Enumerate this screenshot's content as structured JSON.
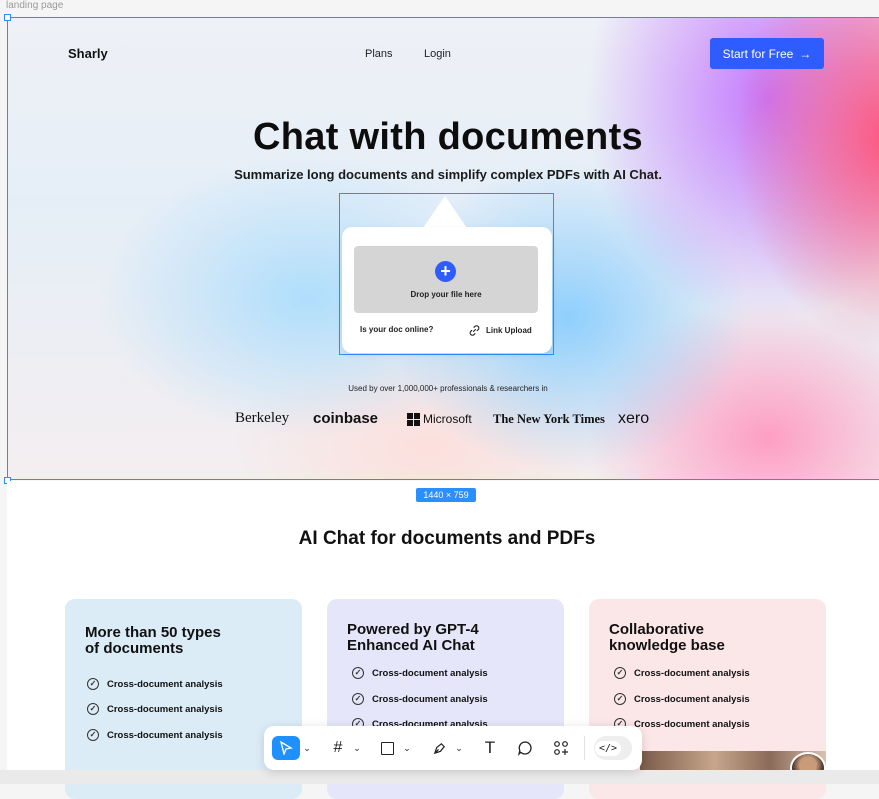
{
  "frame_label": "landing page",
  "header": {
    "brand": "Sharly",
    "nav": [
      "Plans",
      "Login"
    ],
    "cta_label": "Start for Free",
    "cta_arrow": "→"
  },
  "hero": {
    "title": "Chat with documents",
    "subtitle": "Summarize long documents and simplify complex PDFs with AI Chat.",
    "upload": {
      "drop_text": "Drop your file here",
      "online_question": "Is your doc online?",
      "link_upload": "Link Upload"
    },
    "used_by": "Used by over 1,000,000+ professionals & researchers in",
    "logos": [
      "Berkeley",
      "coinbase",
      "Microsoft",
      "The New York Times",
      "xero"
    ]
  },
  "frame_size_badge": "1440 × 759",
  "section": {
    "title": "AI Chat for documents and PDFs",
    "cards": [
      {
        "title_line1": "More than 50 types",
        "title_line2": "of documents",
        "features": [
          "Cross-document analysis",
          "Cross-document analysis",
          "Cross-document analysis"
        ],
        "bg": "#dcecf7"
      },
      {
        "title_line1": "Powered by GPT-4",
        "title_line2": "Enhanced AI Chat",
        "features": [
          "Cross-document analysis",
          "Cross-document analysis",
          "Cross-document analysis"
        ],
        "bg": "#e6e6fb"
      },
      {
        "title_line1": "Collaborative",
        "title_line2": "knowledge base",
        "features": [
          "Cross-document analysis",
          "Cross-document analysis",
          "Cross-document analysis"
        ],
        "bg": "#fbe6e8"
      }
    ]
  },
  "toolbar": {
    "tools": [
      "move-icon",
      "frame-icon",
      "rectangle-icon",
      "pen-icon",
      "text-icon",
      "comment-icon",
      "actions-icon",
      "dev-mode-icon"
    ],
    "text_tool": "T"
  },
  "colors": {
    "accent": "#2f5cff",
    "selection": "#2b8fff"
  }
}
